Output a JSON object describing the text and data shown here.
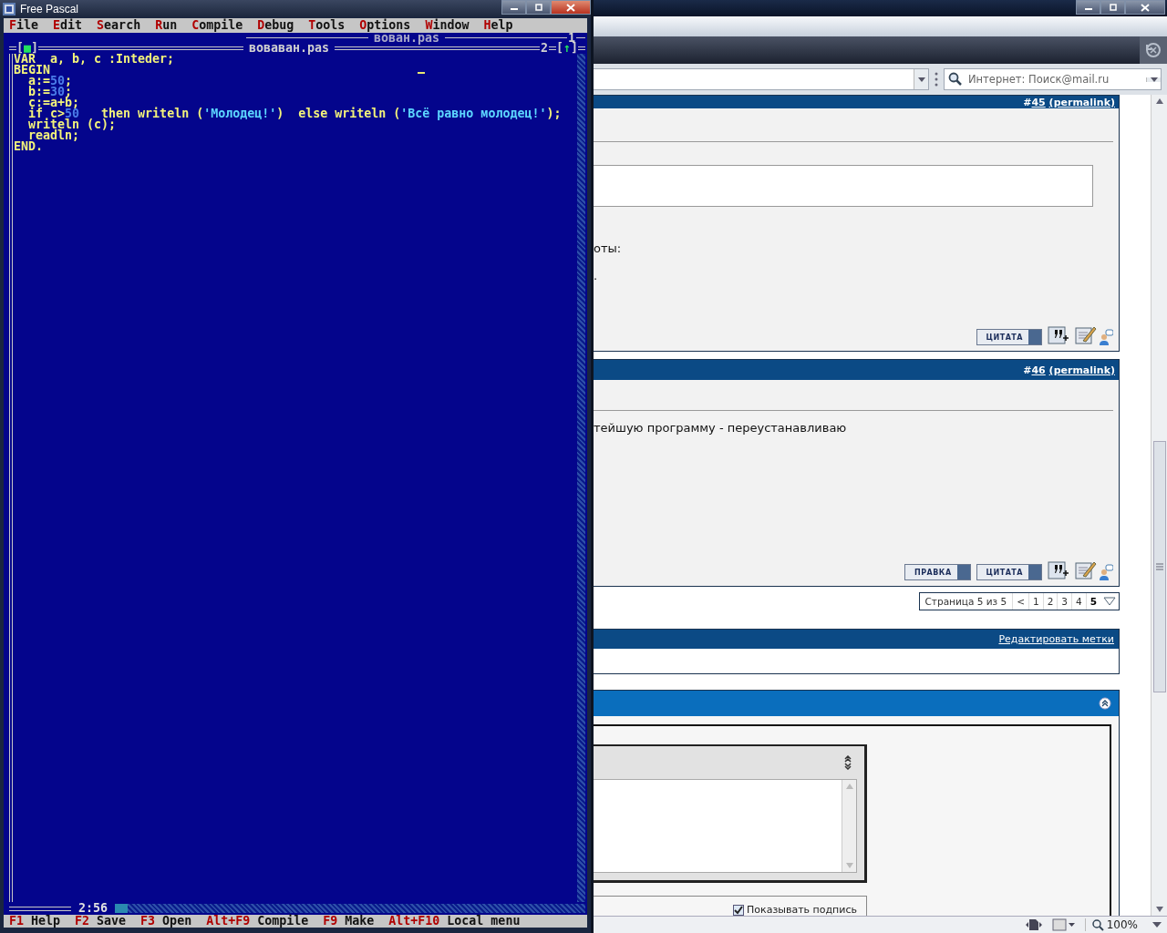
{
  "ide": {
    "title": "Free Pascal",
    "menu": [
      {
        "hotkey": "F",
        "rest": "ile"
      },
      {
        "hotkey": "E",
        "rest": "dit"
      },
      {
        "hotkey": "S",
        "rest": "earch"
      },
      {
        "hotkey": "R",
        "rest": "un"
      },
      {
        "hotkey": "C",
        "rest": "ompile"
      },
      {
        "hotkey": "D",
        "rest": "ebug"
      },
      {
        "hotkey": "T",
        "rest": "ools"
      },
      {
        "hotkey": "O",
        "rest": "ptions"
      },
      {
        "hotkey": "W",
        "rest": "indow"
      },
      {
        "hotkey": "H",
        "rest": "elp"
      }
    ],
    "back_window": {
      "title": "вован.pas",
      "number": "1"
    },
    "editor": {
      "title": "вовaван.pas",
      "close_box": "[■]",
      "number": "2",
      "zoom_box": "[↑]",
      "cursor_pos": "2:56",
      "lines": [
        [
          {
            "kind": "plain",
            "text": "VAR  a, b, c :Inteder;"
          }
        ],
        [
          {
            "kind": "plain",
            "text": "BEGIN"
          }
        ],
        [
          {
            "kind": "plain",
            "text": "  a:="
          },
          {
            "kind": "number",
            "text": "50"
          },
          {
            "kind": "plain",
            "text": ";"
          }
        ],
        [
          {
            "kind": "plain",
            "text": "  b:="
          },
          {
            "kind": "number",
            "text": "30"
          },
          {
            "kind": "plain",
            "text": ";"
          }
        ],
        [
          {
            "kind": "plain",
            "text": "  c:=a+b;"
          }
        ],
        [
          {
            "kind": "plain",
            "text": "  if c>"
          },
          {
            "kind": "number",
            "text": "50"
          },
          {
            "kind": "plain",
            "text": "   then writeln ("
          },
          {
            "kind": "string",
            "text": "'Молодец!'"
          },
          {
            "kind": "plain",
            "text": ")  else writeln ("
          },
          {
            "kind": "string",
            "text": "'Всё равно молодец!'"
          },
          {
            "kind": "plain",
            "text": ");"
          }
        ],
        [
          {
            "kind": "plain",
            "text": "  writeln (c);"
          }
        ],
        [
          {
            "kind": "plain",
            "text": "  readln;"
          }
        ],
        [
          {
            "kind": "plain",
            "text": "END."
          }
        ]
      ]
    },
    "status_keys": [
      {
        "key": "F1",
        "label": "Help"
      },
      {
        "key": "F2",
        "label": "Save"
      },
      {
        "key": "F3",
        "label": "Open"
      },
      {
        "key": "Alt+F9",
        "label": "Compile"
      },
      {
        "key": "F9",
        "label": "Make"
      },
      {
        "key": "Alt+F10",
        "label": "Local menu"
      }
    ]
  },
  "browser": {
    "search_placeholder": "Интернет: Поиск@mail.ru",
    "posts": [
      {
        "prefix": "#",
        "number": "45",
        "link": "(permalink)",
        "lines": [
          "оты:",
          "."
        ],
        "quote_box": true,
        "buttons": [
          "ЦИТАТА"
        ]
      },
      {
        "prefix": "#",
        "number": "46",
        "link": "(permalink)",
        "lines": [
          "тейшую программу - переустанавливаю"
        ],
        "quote_box": false,
        "buttons": [
          "ПРАВКА",
          "ЦИТАТА"
        ]
      }
    ],
    "pagination": {
      "label": "Страница 5 из 5",
      "prev": "<",
      "pages": [
        {
          "label": "1",
          "selected": false
        },
        {
          "label": "2",
          "selected": false
        },
        {
          "label": "3",
          "selected": false
        },
        {
          "label": "4",
          "selected": false
        },
        {
          "label": "5",
          "selected": true
        }
      ]
    },
    "tags_link": "Редактировать метки",
    "signature": {
      "label": "Показывать подпись",
      "checked": true
    },
    "zoom": "100%"
  }
}
